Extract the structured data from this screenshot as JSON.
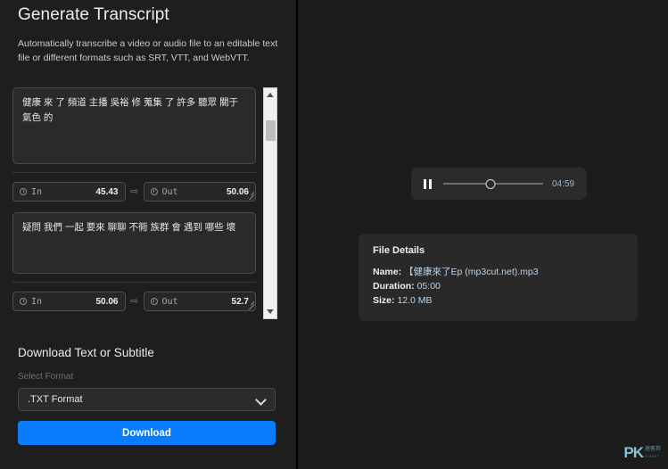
{
  "left": {
    "title": "Generate Transcript",
    "subtitle": "Automatically transcribe a video or audio file to an editable text file or different formats such as SRT, VTT, and WebVTT.",
    "segments": [
      {
        "text": "健康 來 了 頻道 主播 吳裕 修 蒐集 了 許多 聽眾 關于 氣色 的",
        "in_label": "In",
        "in_value": "45.43",
        "out_label": "Out",
        "out_value": "50.06"
      },
      {
        "text": "疑問 我們 一起 要來 聊聊 不衕 族群 會 遇到 哪些 壞",
        "in_label": "In",
        "in_value": "50.06",
        "out_label": "Out",
        "out_value": "52.7"
      }
    ],
    "download": {
      "section_title": "Download Text or Subtitle",
      "format_label": "Select Format",
      "format_value": ".TXT Format",
      "button_label": "Download"
    }
  },
  "right": {
    "player": {
      "time_display": "04:59"
    },
    "file_details": {
      "title": "File Details",
      "name_key": "Name:",
      "name_value": "【健康來了Ep (mp3cut.net).mp3",
      "duration_key": "Duration:",
      "duration_value": "05:00",
      "size_key": "Size:",
      "size_value": "12.0 MB"
    },
    "watermark": {
      "logo": "PK",
      "line1": "痞客邦",
      "line2": "PIXNET"
    }
  },
  "colors": {
    "accent": "#0a7cff",
    "panel": "#1e1e1e",
    "field": "#2a2a2a",
    "time_text": "#95b8d8"
  }
}
